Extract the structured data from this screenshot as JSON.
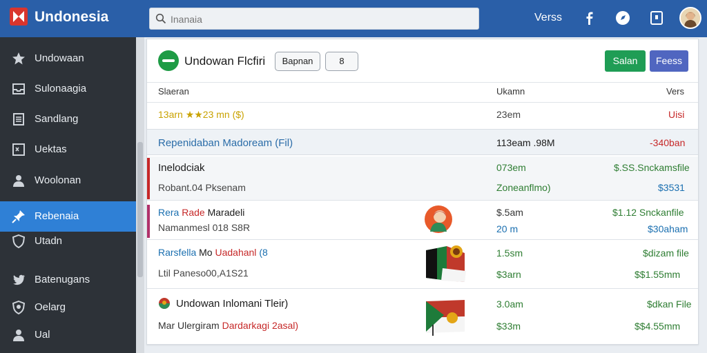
{
  "app": {
    "title": "Undonesia"
  },
  "search": {
    "placeholder": "Inanaia"
  },
  "topbar": {
    "link": "Verss"
  },
  "sidebar": {
    "items": [
      {
        "label": "Undowaan",
        "icon": "star-icon"
      },
      {
        "label": "Sulonaagia",
        "icon": "inbox-icon"
      },
      {
        "label": "Sandlang",
        "icon": "document-icon"
      },
      {
        "label": "Uektas",
        "icon": "checkbox-icon"
      },
      {
        "label": "Woolonan",
        "icon": "user-icon"
      },
      {
        "label": "Rebenaia",
        "icon": "pin-icon",
        "active": true
      },
      {
        "label": "Utadn",
        "icon": "shield-icon"
      },
      {
        "label": "Batenugans",
        "icon": "twitter-icon"
      },
      {
        "label": "Oelarg",
        "icon": "badge-icon"
      },
      {
        "label": "Ual",
        "icon": "user-icon"
      }
    ]
  },
  "card": {
    "title": "Undowan Flcfiri",
    "btn_outline_1": "Bapnan",
    "btn_outline_2": "8",
    "btn_primary": "Salan",
    "btn_secondary": "Feess",
    "columns": {
      "c1": "Slaeran",
      "c2": "Ukamn",
      "c3": "Vers"
    },
    "rows": [
      {
        "left": "13arn ★★23 mn ($)",
        "mid": "23em",
        "right": "Uisi"
      },
      {
        "left": "Repenidaban Madoream (Fil)",
        "mid": "113eam .98M",
        "right": "-340ban"
      },
      {
        "left_top": "Inelodciak",
        "left_bottom": "Robant.04 Pksenam",
        "mid_top": "073em",
        "mid_bottom": "Zoneanflmo)",
        "right_top": "$.SS.Snckamsfile",
        "right_bottom": "$3531"
      },
      {
        "left_top_a": "Rera",
        "left_top_b": "Rade",
        "left_top_c": "Maradeli",
        "left_bottom": "Namanmesl 018 S8R",
        "mid_top": "$.5am",
        "mid_bottom": "20 m",
        "right_top": "$1.12 Snckanfile",
        "right_bottom": "$30aham"
      },
      {
        "left_top_a": "Rarsfella",
        "left_top_b": "Mo",
        "left_top_c": "Uadahanl",
        "left_top_d": "(8",
        "left_bottom": "Ltil Paneso00,A1S21",
        "mid_top": "1.5sm",
        "mid_bottom": "$3arn",
        "right_top": "$dizam file",
        "right_bottom": "$$1.55mm"
      },
      {
        "left_top": "Undowan Inlomani Tleir)",
        "left_bottom_a": "Mar Ulergiram",
        "left_bottom_b": "Dardarkagi 2asal)",
        "mid_top": "3.0am",
        "mid_bottom": "$33m",
        "right_top": "$dkan File",
        "right_bottom": "$$4.55mm"
      }
    ]
  }
}
